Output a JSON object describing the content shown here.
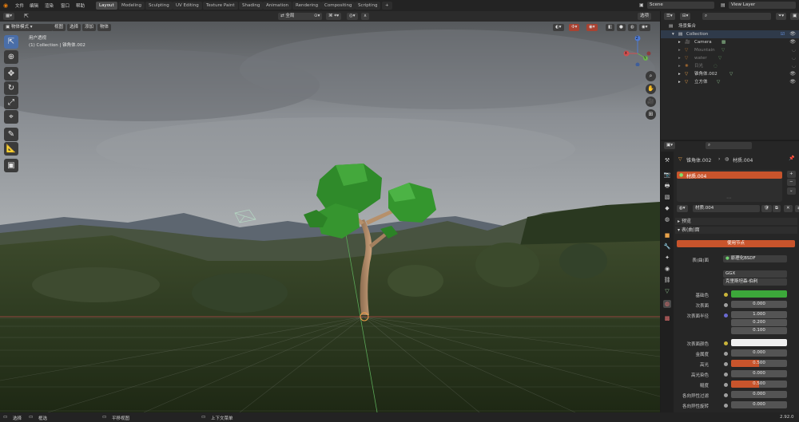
{
  "menu": [
    "文件",
    "编辑",
    "渲染",
    "窗口",
    "帮助"
  ],
  "workspaces": [
    "Layout",
    "Modeling",
    "Sculpting",
    "UV Editing",
    "Texture Paint",
    "Shading",
    "Animation",
    "Rendering",
    "Compositing",
    "Scripting"
  ],
  "add_tab": "+",
  "scene_name": "Scene",
  "view_layer": "View Layer",
  "header": {
    "mode": "物体模式",
    "view": "视图",
    "select": "选择",
    "add": "添加",
    "object": "物体",
    "orientation": "全局",
    "options": "选项"
  },
  "viewport": {
    "view_name": "用户透视",
    "collection_info": "(1) Collection | 锥角体.002"
  },
  "gizmo": {
    "x": "X",
    "y": "Y",
    "z": "Z"
  },
  "status": {
    "select": "选择",
    "box": "框选",
    "pan": "平移视图",
    "context": "上下文菜单",
    "version": "2.92.0"
  },
  "outliner": {
    "root": "场景集合",
    "collection": "Collection",
    "items": [
      {
        "label": "Camera",
        "muted": false
      },
      {
        "label": "Mountain",
        "muted": true
      },
      {
        "label": "water",
        "muted": true
      },
      {
        "label": "日光",
        "muted": true
      },
      {
        "label": "锥角体.002",
        "muted": false
      },
      {
        "label": "立方体",
        "muted": false
      }
    ]
  },
  "properties": {
    "breadcrumb_object": "锥角体.002",
    "breadcrumb_material": "材质.004",
    "slot": "材质.004",
    "material_name": "材质.004",
    "panel_preview": "预览",
    "panel_surface": "表(曲)面",
    "use_nodes": "使用节点",
    "surface_label": "表(曲)面",
    "surface_value": "原理化BSDF",
    "distribution": "GGX",
    "subsurface_method": "克里斯坦森-伯利",
    "base_color_label": "基础色",
    "subsurface_label": "次表面",
    "subsurface_value": "0.000",
    "subsurface_radius_label": "次表面半径",
    "radius": [
      "1.000",
      "0.200",
      "0.100"
    ],
    "subsurface_color_label": "次表面颜色",
    "metallic_label": "金属度",
    "metallic_value": "0.000",
    "specular_label": "高光",
    "specular_value": "0.500",
    "specular_tint_label": "高光染色",
    "specular_tint_value": "0.000",
    "roughness_label": "糙度",
    "roughness_value": "0.500",
    "anisotropic_label": "各向异性过滤",
    "anisotropic_value": "0.000",
    "anisotropic_rotation_label": "各向异性旋转",
    "anisotropic_rotation_value": "0.000"
  },
  "colors": {
    "accent": "#e05e2f",
    "base_color": "#3ca83a",
    "active_tool": "#4a6ea8",
    "grid_x": "#b54848",
    "grid_y": "#5aa857"
  },
  "specular_fraction": 0.5,
  "roughness_fraction": 0.5
}
